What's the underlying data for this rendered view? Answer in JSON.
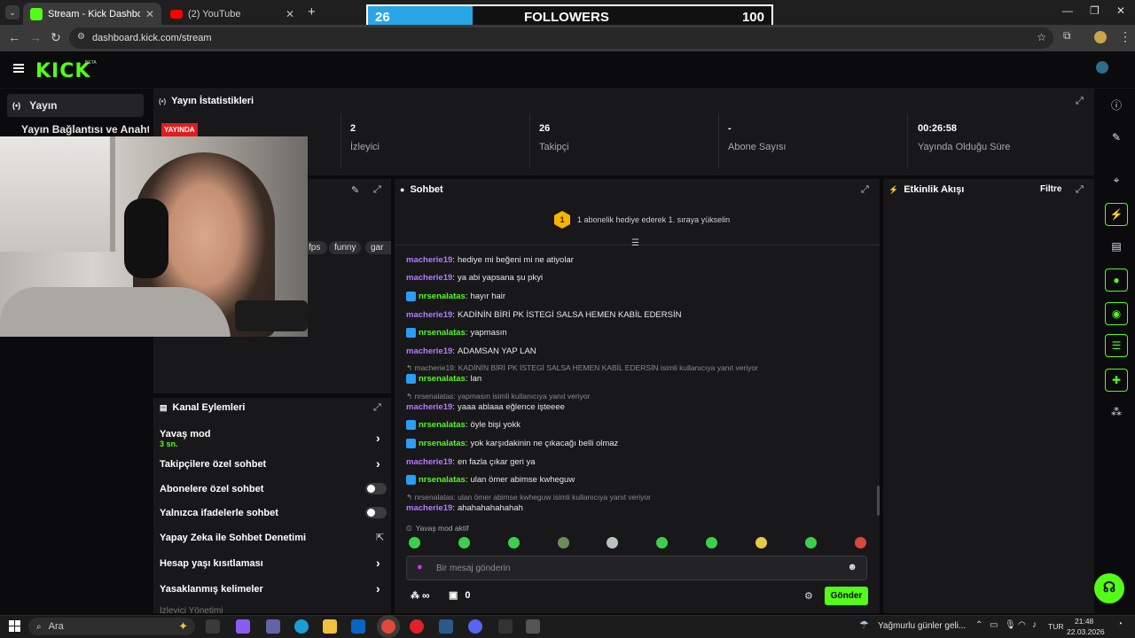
{
  "browser": {
    "tabs": [
      {
        "title": "Stream - Kick Dashboard",
        "active": true
      },
      {
        "title": "(2) YouTube",
        "active": false
      }
    ],
    "url": "dashboard.kick.com/stream"
  },
  "overlay": {
    "current": "26",
    "label": "FOLLOWERS",
    "goal": "100",
    "progress_fraction": 0.26
  },
  "kick": {
    "logo": "KICK",
    "beta": "BETA"
  },
  "sidebar": {
    "items": [
      {
        "label": "Yayın"
      },
      {
        "label": "Yayın Bağlantısı ve Anahtarı"
      }
    ]
  },
  "stats": {
    "title": "Yayın İstatistikleri",
    "live_badge": "YAYINDA",
    "items": [
      {
        "value": "2",
        "label": "İzleyici"
      },
      {
        "value": "26",
        "label": "Takipçi"
      },
      {
        "value": "-",
        "label": "Abone Sayısı"
      },
      {
        "value": "00:26:58",
        "label": "Yayında Olduğu Süre"
      }
    ]
  },
  "tags": [
    "fps",
    "funny",
    "gar"
  ],
  "chat": {
    "title": "Sohbet",
    "promo": "1 abonelik hediye ederek 1. sıraya yükselin",
    "promo_rank": "1",
    "messages": [
      {
        "user": "macherie19",
        "text": "hediye mi beğeni mi ne atiyolar",
        "color": "purple"
      },
      {
        "user": "macherie19",
        "text": "ya abi yapsana şu pkyi",
        "color": "purple"
      },
      {
        "user": "nrsenalatas",
        "text": "hayır hair",
        "color": "green"
      },
      {
        "user": "macherie19",
        "text": "KADİNİN BİRİ PK İSTEGİ SALSA HEMEN KABİL EDERSİN",
        "color": "purple"
      },
      {
        "user": "nrsenalatas",
        "text": "yapmasın",
        "color": "green"
      },
      {
        "user": "macherie19",
        "text": "ADAMSAN YAP LAN",
        "color": "purple"
      },
      {
        "reply": "macherie19: KADİNİN BİRİ PK İSTEGİ SALSA HEMEN KABİL EDERSİN isimli kullanıcıya yanıt veriyor"
      },
      {
        "user": "nrsenalatas",
        "text": "lan",
        "color": "green"
      },
      {
        "reply": "nrsenalatas: yapmasın isimli kullanıcıya yanıt veriyor"
      },
      {
        "user": "macherie19",
        "text": "yaaa ablaaa eğlence işteeee",
        "color": "purple"
      },
      {
        "user": "nrsenalatas",
        "text": "öyle bişi yokk",
        "color": "green"
      },
      {
        "user": "nrsenalatas",
        "text": "yok karşıdakinin ne çıkacağı belli olmaz",
        "color": "green"
      },
      {
        "user": "macherie19",
        "text": "en fazla çıkar geri ya",
        "color": "purple"
      },
      {
        "user": "nrsenalatas",
        "text": "ulan ömer abimse kwheguw",
        "color": "green"
      },
      {
        "reply": "nrsenalatas: ulan ömer abimse kwheguw isimli kullanıcıya yanıt veriyor"
      },
      {
        "user": "macherie19",
        "text": "ahahahahahahah",
        "color": "purple"
      }
    ],
    "slow_mode": "Yavaş mod aktif",
    "input_placeholder": "Bir mesaj gönderin",
    "infinity": "∞",
    "count": "0",
    "send": "Gönder"
  },
  "activity": {
    "title": "Etkinlik Akışı",
    "filter": "Filtre"
  },
  "actions": {
    "title": "Kanal Eylemleri",
    "items": [
      {
        "label": "Yavaş mod",
        "sub": "3 sn.",
        "control": "chevron"
      },
      {
        "label": "Takipçilere özel sohbet",
        "control": "chevron"
      },
      {
        "label": "Abonelere özel sohbet",
        "control": "toggle"
      },
      {
        "label": "Yalnızca ifadelerle sohbet",
        "control": "toggle"
      },
      {
        "label": "Yapay Zeka ile Sohbet Denetimi",
        "control": "external"
      },
      {
        "label": "Hesap yaşı kısıtlaması",
        "control": "chevron"
      },
      {
        "label": "Yasaklanmış kelimeler",
        "control": "chevron"
      }
    ],
    "cutoff": "İzleyici Yönetimi"
  },
  "taskbar": {
    "search": "Ara",
    "weather": "Yağmurlu günler geli...",
    "lang": "TUR",
    "time": "21:48",
    "date": "22.03.2026"
  },
  "colors": {
    "kick_green": "#53fc18",
    "panel": "#18181b",
    "bg": "#0b0b0d",
    "overlay_blue": "#2aa6e6",
    "live_red": "#e11d1d"
  }
}
